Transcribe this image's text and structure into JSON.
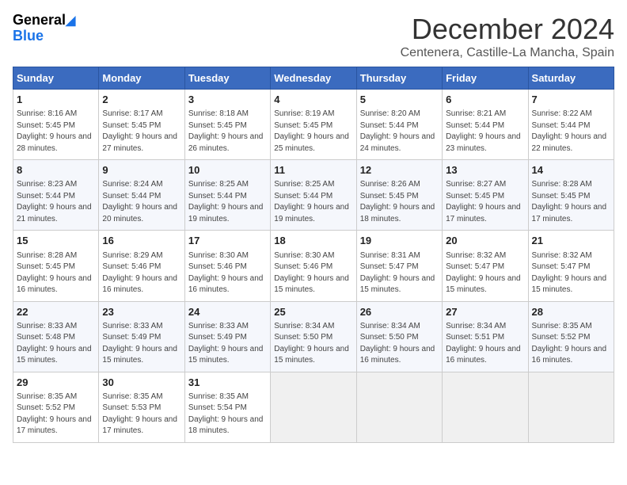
{
  "logo": {
    "general": "General",
    "blue": "Blue"
  },
  "header": {
    "month": "December 2024",
    "location": "Centenera, Castille-La Mancha, Spain"
  },
  "weekdays": [
    "Sunday",
    "Monday",
    "Tuesday",
    "Wednesday",
    "Thursday",
    "Friday",
    "Saturday"
  ],
  "weeks": [
    [
      {
        "day": "1",
        "sunrise": "8:16 AM",
        "sunset": "5:45 PM",
        "daylight": "9 hours and 28 minutes."
      },
      {
        "day": "2",
        "sunrise": "8:17 AM",
        "sunset": "5:45 PM",
        "daylight": "9 hours and 27 minutes."
      },
      {
        "day": "3",
        "sunrise": "8:18 AM",
        "sunset": "5:45 PM",
        "daylight": "9 hours and 26 minutes."
      },
      {
        "day": "4",
        "sunrise": "8:19 AM",
        "sunset": "5:45 PM",
        "daylight": "9 hours and 25 minutes."
      },
      {
        "day": "5",
        "sunrise": "8:20 AM",
        "sunset": "5:44 PM",
        "daylight": "9 hours and 24 minutes."
      },
      {
        "day": "6",
        "sunrise": "8:21 AM",
        "sunset": "5:44 PM",
        "daylight": "9 hours and 23 minutes."
      },
      {
        "day": "7",
        "sunrise": "8:22 AM",
        "sunset": "5:44 PM",
        "daylight": "9 hours and 22 minutes."
      }
    ],
    [
      {
        "day": "8",
        "sunrise": "8:23 AM",
        "sunset": "5:44 PM",
        "daylight": "9 hours and 21 minutes."
      },
      {
        "day": "9",
        "sunrise": "8:24 AM",
        "sunset": "5:44 PM",
        "daylight": "9 hours and 20 minutes."
      },
      {
        "day": "10",
        "sunrise": "8:25 AM",
        "sunset": "5:44 PM",
        "daylight": "9 hours and 19 minutes."
      },
      {
        "day": "11",
        "sunrise": "8:25 AM",
        "sunset": "5:44 PM",
        "daylight": "9 hours and 19 minutes."
      },
      {
        "day": "12",
        "sunrise": "8:26 AM",
        "sunset": "5:45 PM",
        "daylight": "9 hours and 18 minutes."
      },
      {
        "day": "13",
        "sunrise": "8:27 AM",
        "sunset": "5:45 PM",
        "daylight": "9 hours and 17 minutes."
      },
      {
        "day": "14",
        "sunrise": "8:28 AM",
        "sunset": "5:45 PM",
        "daylight": "9 hours and 17 minutes."
      }
    ],
    [
      {
        "day": "15",
        "sunrise": "8:28 AM",
        "sunset": "5:45 PM",
        "daylight": "9 hours and 16 minutes."
      },
      {
        "day": "16",
        "sunrise": "8:29 AM",
        "sunset": "5:46 PM",
        "daylight": "9 hours and 16 minutes."
      },
      {
        "day": "17",
        "sunrise": "8:30 AM",
        "sunset": "5:46 PM",
        "daylight": "9 hours and 16 minutes."
      },
      {
        "day": "18",
        "sunrise": "8:30 AM",
        "sunset": "5:46 PM",
        "daylight": "9 hours and 15 minutes."
      },
      {
        "day": "19",
        "sunrise": "8:31 AM",
        "sunset": "5:47 PM",
        "daylight": "9 hours and 15 minutes."
      },
      {
        "day": "20",
        "sunrise": "8:32 AM",
        "sunset": "5:47 PM",
        "daylight": "9 hours and 15 minutes."
      },
      {
        "day": "21",
        "sunrise": "8:32 AM",
        "sunset": "5:47 PM",
        "daylight": "9 hours and 15 minutes."
      }
    ],
    [
      {
        "day": "22",
        "sunrise": "8:33 AM",
        "sunset": "5:48 PM",
        "daylight": "9 hours and 15 minutes."
      },
      {
        "day": "23",
        "sunrise": "8:33 AM",
        "sunset": "5:49 PM",
        "daylight": "9 hours and 15 minutes."
      },
      {
        "day": "24",
        "sunrise": "8:33 AM",
        "sunset": "5:49 PM",
        "daylight": "9 hours and 15 minutes."
      },
      {
        "day": "25",
        "sunrise": "8:34 AM",
        "sunset": "5:50 PM",
        "daylight": "9 hours and 15 minutes."
      },
      {
        "day": "26",
        "sunrise": "8:34 AM",
        "sunset": "5:50 PM",
        "daylight": "9 hours and 16 minutes."
      },
      {
        "day": "27",
        "sunrise": "8:34 AM",
        "sunset": "5:51 PM",
        "daylight": "9 hours and 16 minutes."
      },
      {
        "day": "28",
        "sunrise": "8:35 AM",
        "sunset": "5:52 PM",
        "daylight": "9 hours and 16 minutes."
      }
    ],
    [
      {
        "day": "29",
        "sunrise": "8:35 AM",
        "sunset": "5:52 PM",
        "daylight": "9 hours and 17 minutes."
      },
      {
        "day": "30",
        "sunrise": "8:35 AM",
        "sunset": "5:53 PM",
        "daylight": "9 hours and 17 minutes."
      },
      {
        "day": "31",
        "sunrise": "8:35 AM",
        "sunset": "5:54 PM",
        "daylight": "9 hours and 18 minutes."
      },
      null,
      null,
      null,
      null
    ]
  ]
}
